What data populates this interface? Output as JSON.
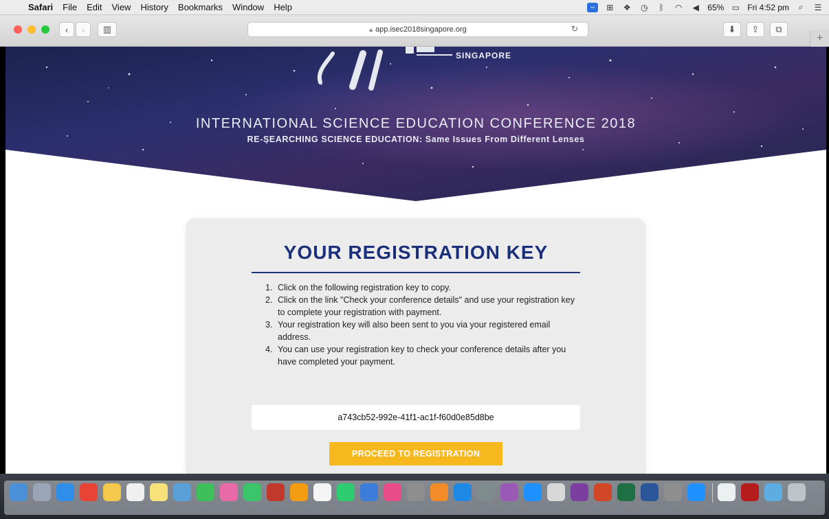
{
  "menubar": {
    "app": "Safari",
    "items": [
      "File",
      "Edit",
      "View",
      "History",
      "Bookmarks",
      "Window",
      "Help"
    ],
    "battery": "65%",
    "clock": "Fri 4:52 pm"
  },
  "browser": {
    "url": "app.isec2018singapore.org"
  },
  "hero": {
    "logo_text": "SINGAPORE",
    "title": "INTERNATIONAL SCIENCE EDUCATION CONFERENCE 2018",
    "subtitle": "RE-SEARCHING SCIENCE EDUCATION: Same Issues From Different Lenses"
  },
  "card": {
    "title": "YOUR REGISTRATION KEY",
    "steps": [
      {
        "num": "1.",
        "text": "Click on the following registration key to copy."
      },
      {
        "num": "2.",
        "text": "Click on the link \"Check your conference details\" and use your registration key to complete your registration with payment."
      },
      {
        "num": "3.",
        "text": "Your registration key will also been sent to you via your registered email address."
      },
      {
        "num": "4.",
        "text": "You can use your registration key to check your conference details after you have completed your payment."
      }
    ],
    "registration_key": "a743cb52-992e-41f1-ac1f-f60d0e85d8be",
    "proceed_label": "PROCEED TO REGISTRATION"
  },
  "colors": {
    "accent_navy": "#1b2f7a",
    "button_yellow": "#f6b81c",
    "card_bg": "#ececec"
  },
  "dock": {
    "apps": [
      "finder-icon",
      "launchpad-icon",
      "safari-icon",
      "chrome-icon",
      "notes-icon",
      "calendar-icon",
      "stickies-icon",
      "preview-icon",
      "messages-icon",
      "photos-icon",
      "facetime-icon",
      "photobooth-icon",
      "photos2-icon",
      "textedit-icon",
      "numbers-icon",
      "keynote-icon",
      "itunes-icon",
      "help-icon",
      "ibooks-icon",
      "appstore-icon",
      "system-prefs-icon",
      "siri-icon",
      "teamviewer-icon",
      "clipboard-icon",
      "onenote-icon",
      "powerpoint-icon",
      "excel-icon",
      "word-icon",
      "help2-icon",
      "teamviewer2-icon",
      "documents-icon",
      "acrobat-icon",
      "mail-icon",
      "trash-icon"
    ]
  }
}
